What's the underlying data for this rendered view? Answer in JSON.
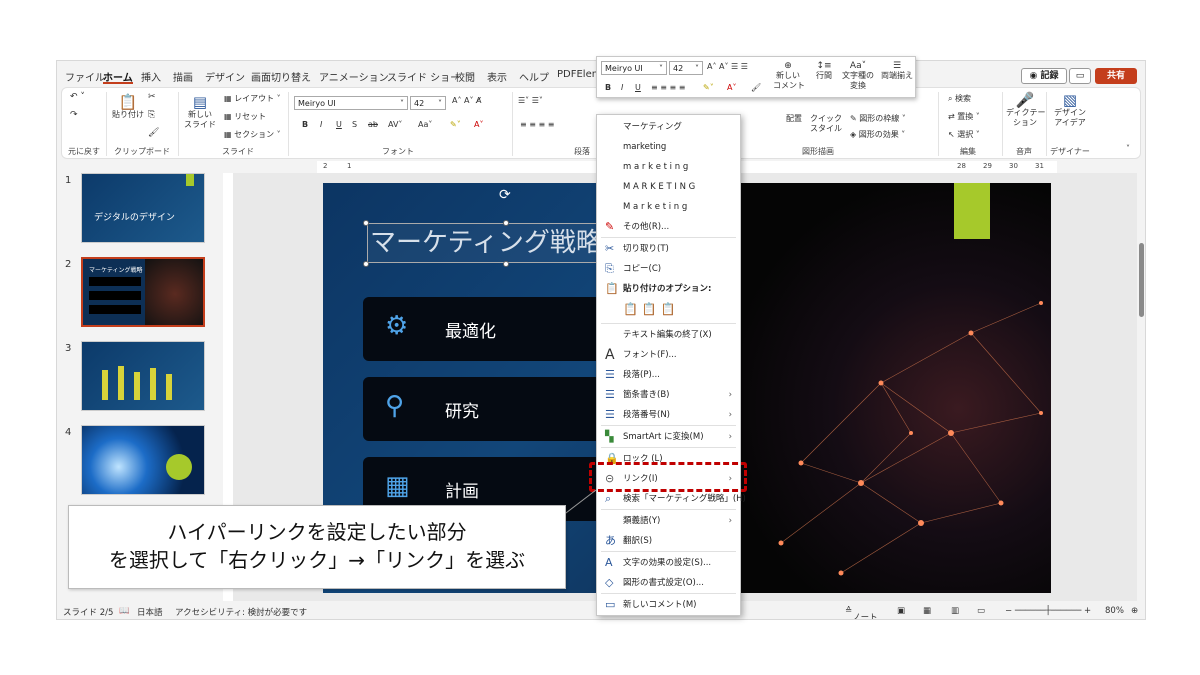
{
  "tabs": [
    "ファイル",
    "ホーム",
    "挿入",
    "描画",
    "デザイン",
    "画面切り替え",
    "アニメーション",
    "スライド ショー",
    "校閲",
    "表示",
    "ヘルプ",
    "PDFElem"
  ],
  "header": {
    "record": "◉ 記録",
    "share": "共有"
  },
  "ribbon": {
    "undo_group": "元に戻す",
    "clipboard": {
      "paste": "貼り付け",
      "group": "クリップボード"
    },
    "slides": {
      "new_slide_1": "新しい",
      "new_slide_2": "スライド",
      "layout": "レイアウト",
      "reset": "リセット",
      "section": "セクション",
      "group": "スライド"
    },
    "font": {
      "name": "Meiryo UI",
      "size": "42",
      "group": "フォント"
    },
    "paragraph": {
      "group": "段落"
    },
    "drawing": {
      "arrange": "配置",
      "quick_1": "クイック",
      "quick_2": "スタイル",
      "fill": "図形の枠線",
      "effect": "図形の効果",
      "group": "図形描画"
    },
    "editing": {
      "search": "検索",
      "replace": "置換",
      "select": "選択",
      "group": "編集"
    },
    "voice": {
      "dictate_1": "ディクテー",
      "dictate_2": "ション",
      "group": "音声"
    },
    "designer": {
      "label_1": "デザイン",
      "label_2": "アイデア",
      "group": "デザイナー"
    }
  },
  "mini_toolbar": {
    "font": "Meiryo UI",
    "size": "42",
    "new_comment_1": "新しい",
    "new_comment_2": "コメント",
    "line_spacing": "行間",
    "convert_1": "文字種の",
    "convert_2": "変換",
    "align_both": "両端揃え"
  },
  "ruler_ticks": [
    "2",
    "1",
    "28",
    "29",
    "30",
    "31"
  ],
  "slides_panel": [
    {
      "num": "1",
      "title": "デジタルのデザイン"
    },
    {
      "num": "2",
      "title": "マーケティング戦略"
    },
    {
      "num": "3",
      "title": ""
    },
    {
      "num": "4",
      "title": ""
    }
  ],
  "slide": {
    "title": "マーケティング戦略",
    "items": [
      {
        "label": "最適化",
        "icon": "gears-icon"
      },
      {
        "label": "研究",
        "icon": "search-icon"
      },
      {
        "label": "計画",
        "icon": "calendar-icon"
      }
    ]
  },
  "context_menu": {
    "suggestions": [
      "マーケティング",
      "marketing",
      "m a r k e t i n g",
      "M A R K E T I N G",
      "M a r k e t i n g"
    ],
    "items": [
      {
        "label": "その他(R)..."
      },
      {
        "label": "切り取り(T)"
      },
      {
        "label": "コピー(C)"
      },
      {
        "label": "貼り付けのオプション:"
      },
      {
        "label": "テキスト編集の終了(X)"
      },
      {
        "label": "フォント(F)..."
      },
      {
        "label": "段落(P)..."
      },
      {
        "label": "箇条書き(B)"
      },
      {
        "label": "段落番号(N)"
      },
      {
        "label": "SmartArt に変換(M)"
      },
      {
        "label": "ロック (L)"
      },
      {
        "label": "リンク(I)"
      },
      {
        "label": "検索「マーケティング戦略」(H)"
      },
      {
        "label": "類義語(Y)"
      },
      {
        "label": "翻訳(S)"
      },
      {
        "label": "文字の効果の設定(S)..."
      },
      {
        "label": "図形の書式設定(O)..."
      },
      {
        "label": "新しいコメント(M)"
      }
    ]
  },
  "callout": {
    "line1": "ハイパーリンクを設定したい部分",
    "line2": "を選択して「右クリック」→「リンク」を選ぶ"
  },
  "status": {
    "slide": "スライド 2/5",
    "lang": "日本語",
    "accessibility": "アクセシビリティ: 検討が必要です",
    "notes": "ノート",
    "zoom": "80%"
  }
}
